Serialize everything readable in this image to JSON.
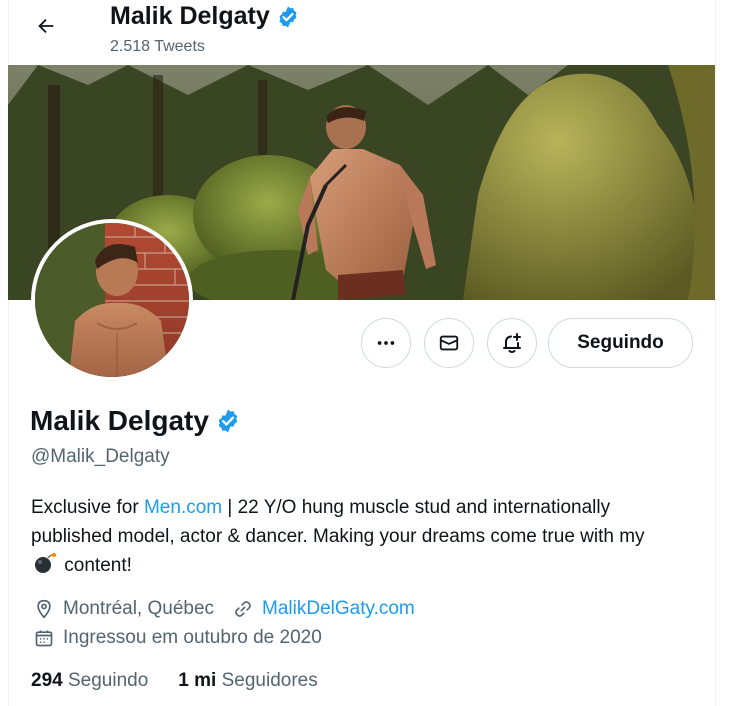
{
  "header": {
    "name": "Malik Delgaty",
    "tweet_count": "2.518 Tweets"
  },
  "profile": {
    "display_name": "Malik Delgaty",
    "handle": "@Malik_Delgaty",
    "bio": {
      "prefix": "Exclusive for ",
      "link": "Men.com",
      "middle": " | 22 Y/O hung muscle stud and internationally published model, actor & dancer. Making your dreams come true with my ",
      "suffix": " content!"
    },
    "location": "Montréal, Québec",
    "website": "MalikDelGaty.com",
    "joined": "Ingressou em outubro de 2020",
    "following_count": "294",
    "following_label": "Seguindo",
    "followers_count": "1 mi",
    "followers_label": "Seguidores"
  },
  "actions": {
    "follow_label": "Seguindo"
  },
  "colors": {
    "accent": "#1d9bf0",
    "secondary_text": "#536471",
    "border": "#cfd9de"
  },
  "icons": [
    "back-arrow-icon",
    "verified-badge-icon",
    "more-icon",
    "message-icon",
    "notification-bell-icon",
    "location-icon",
    "link-icon",
    "calendar-icon",
    "bomb-emoji-icon"
  ]
}
